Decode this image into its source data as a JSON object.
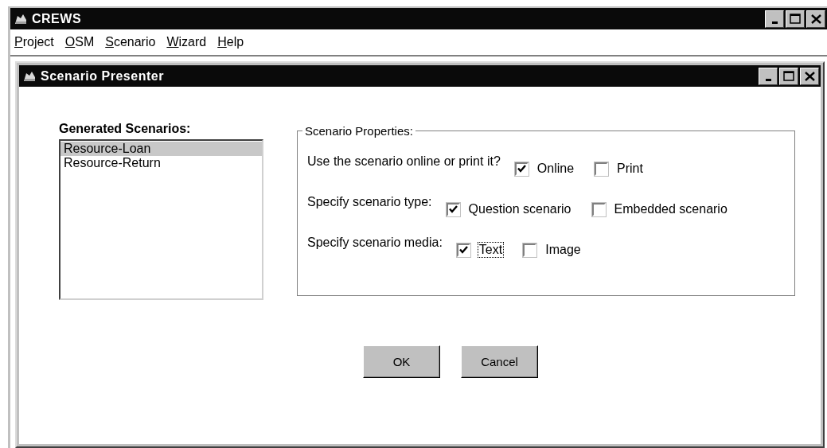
{
  "window": {
    "title": "CREWS"
  },
  "menu": [
    {
      "label": "Project"
    },
    {
      "label": "OSM"
    },
    {
      "label": "Scenario"
    },
    {
      "label": "Wizard"
    },
    {
      "label": "Help"
    }
  ],
  "dialog": {
    "title": "Scenario Presenter",
    "list_label": "Generated Scenarios:",
    "scenarios": [
      {
        "label": "Resource-Loan",
        "selected": true
      },
      {
        "label": "Resource-Return",
        "selected": false
      }
    ],
    "group_title": "Scenario Properties:",
    "rows": [
      {
        "label": "Use the scenario online or print it?",
        "options": [
          {
            "label": "Online",
            "checked": true,
            "focused": false
          },
          {
            "label": "Print",
            "checked": false,
            "focused": false
          }
        ]
      },
      {
        "label": "Specify scenario type:",
        "options": [
          {
            "label": "Question scenario",
            "checked": true,
            "focused": false
          },
          {
            "label": "Embedded scenario",
            "checked": false,
            "focused": false
          }
        ]
      },
      {
        "label": "Specify scenario media:",
        "options": [
          {
            "label": "Text",
            "checked": true,
            "focused": true
          },
          {
            "label": "Image",
            "checked": false,
            "focused": false
          }
        ]
      }
    ],
    "buttons": [
      {
        "label": "OK"
      },
      {
        "label": "Cancel"
      }
    ]
  }
}
